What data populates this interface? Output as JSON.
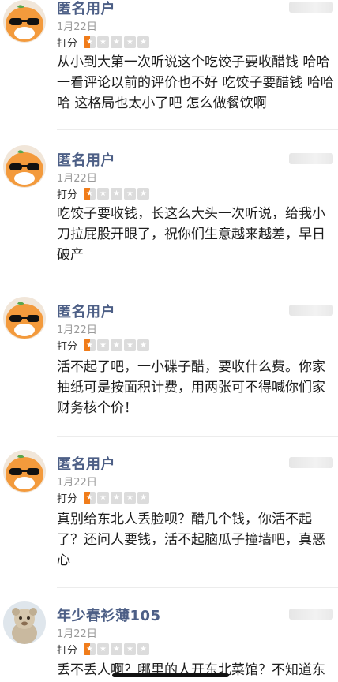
{
  "rating_label": "打分",
  "reviews": [
    {
      "name": "匿名用户",
      "date": "1月22日",
      "stars": 0.5,
      "lines": [
        "从小到大第一次听说这个吃饺子要收醋钱 哈哈",
        "一看评论以前的评价也不好 吃饺子要醋钱 哈哈",
        "哈 这格局也太小了吧 怎么做餐饮啊"
      ]
    },
    {
      "name": "匿名用户",
      "date": "1月22日",
      "stars": 0.5,
      "lines": [
        "吃饺子要收钱，长这么大头一次听说，给我小",
        "刀拉屁股开眼了，祝你们生意越来越差，早日",
        "破产"
      ]
    },
    {
      "name": "匿名用户",
      "date": "1月22日",
      "stars": 0.5,
      "lines": [
        "活不起了吧，一小碟子醋，要收什么费。你家",
        "抽纸可是按面积计费，用两张可不得喊你们家",
        "财务核个价！"
      ]
    },
    {
      "name": "匿名用户",
      "date": "1月22日",
      "stars": 0.5,
      "lines": [
        "真别给东北人丢脸呗？醋几个钱，你活不起",
        "了？还问人要钱，活不起脑瓜子撞墙吧，真恶",
        "心"
      ]
    },
    {
      "name": "年少春衫薄105",
      "date": "1月22日",
      "stars": 0.5,
      "lines": [
        "丢不丢人啊？哪里的人开东北菜馆？不知道东"
      ]
    }
  ]
}
